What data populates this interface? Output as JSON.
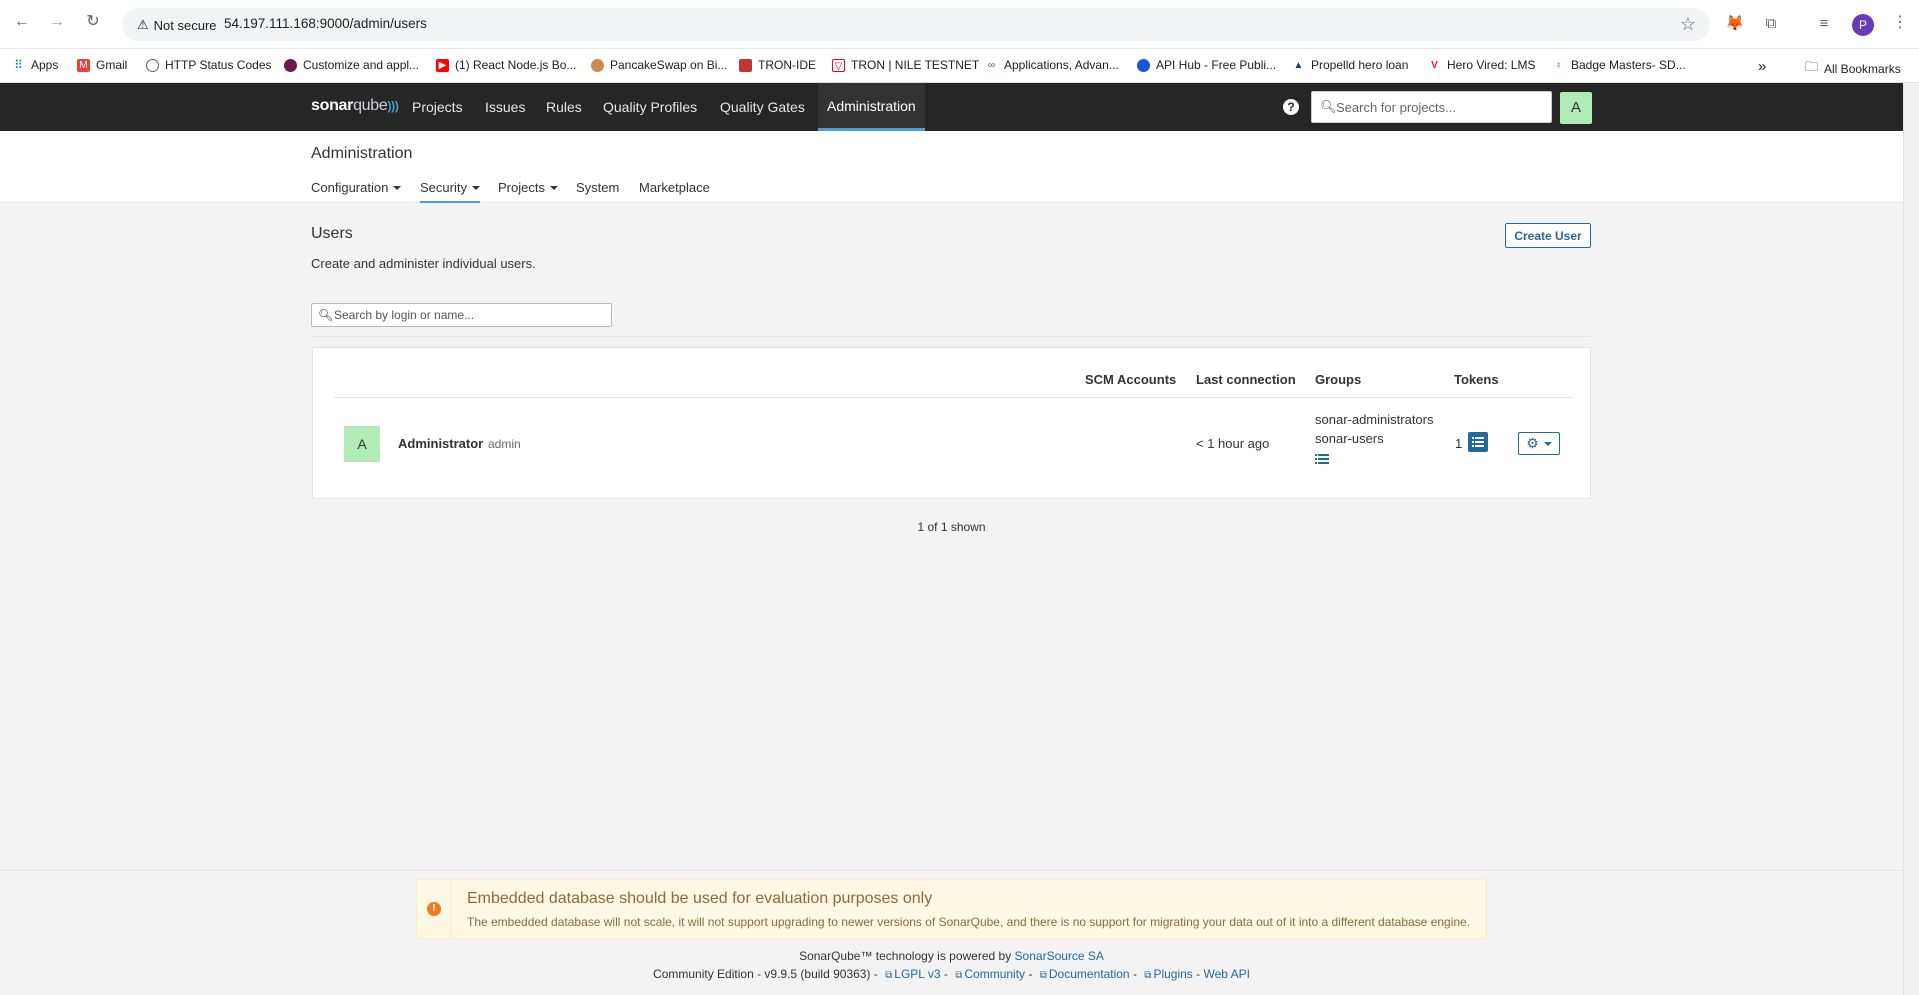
{
  "browser": {
    "security_label": "Not secure",
    "url": "54.197.111.168:9000/admin/users",
    "profile_initial": "P",
    "bookmarks": [
      {
        "label": "Apps"
      },
      {
        "label": "Gmail"
      },
      {
        "label": "HTTP Status Codes"
      },
      {
        "label": "Customize and appl..."
      },
      {
        "label": "(1) React Node.js Bo..."
      },
      {
        "label": "PancakeSwap on Bi..."
      },
      {
        "label": "TRON-IDE"
      },
      {
        "label": "TRON | NILE TESTNET"
      },
      {
        "label": "Applications, Advan..."
      },
      {
        "label": "API Hub - Free Publi..."
      },
      {
        "label": "Propelld hero loan"
      },
      {
        "label": "Hero Vired: LMS"
      },
      {
        "label": "Badge Masters- SD..."
      }
    ],
    "all_bookmarks": "All Bookmarks",
    "more": "»"
  },
  "sonar_nav": {
    "logo_main": "sonar",
    "logo_accent": "qube",
    "items": [
      "Projects",
      "Issues",
      "Rules",
      "Quality Profiles",
      "Quality Gates",
      "Administration"
    ],
    "active": "Administration",
    "search_placeholder": "Search for projects...",
    "avatar_initial": "A"
  },
  "admin": {
    "title": "Administration",
    "menu": [
      "Configuration",
      "Security",
      "Projects",
      "System",
      "Marketplace"
    ]
  },
  "users_page": {
    "title": "Users",
    "description": "Create and administer individual users.",
    "create_button": "Create User",
    "search_placeholder": "Search by login or name...",
    "columns": [
      "SCM Accounts",
      "Last connection",
      "Groups",
      "Tokens"
    ],
    "rows": [
      {
        "avatar": "A",
        "name": "Administrator",
        "login": "admin",
        "last_connection": "< 1 hour ago",
        "groups": [
          "sonar-administrators",
          "sonar-users"
        ],
        "tokens": "1"
      }
    ],
    "shown": "1 of 1 shown"
  },
  "footer": {
    "alert_title": "Embedded database should be used for evaluation purposes only",
    "alert_text": "The embedded database will not scale, it will not support upgrading to newer versions of SonarQube, and there is no support for migrating your data out of it into a different database engine.",
    "powered_prefix": "SonarQube™ technology is powered by",
    "powered_link": "SonarSource SA",
    "edition": "Community Edition - v9.9.5 (build 90363) -",
    "links": [
      "LGPL v3",
      "Community",
      "Documentation",
      "Plugins",
      "Web API"
    ],
    "sep": "-"
  },
  "colors": {
    "nav_bg": "#262626",
    "accent": "#236a97",
    "active_underline": "#4b9fd5",
    "avatar_bg": "#b1ecb7",
    "warning_icon": "#ed7d20"
  }
}
